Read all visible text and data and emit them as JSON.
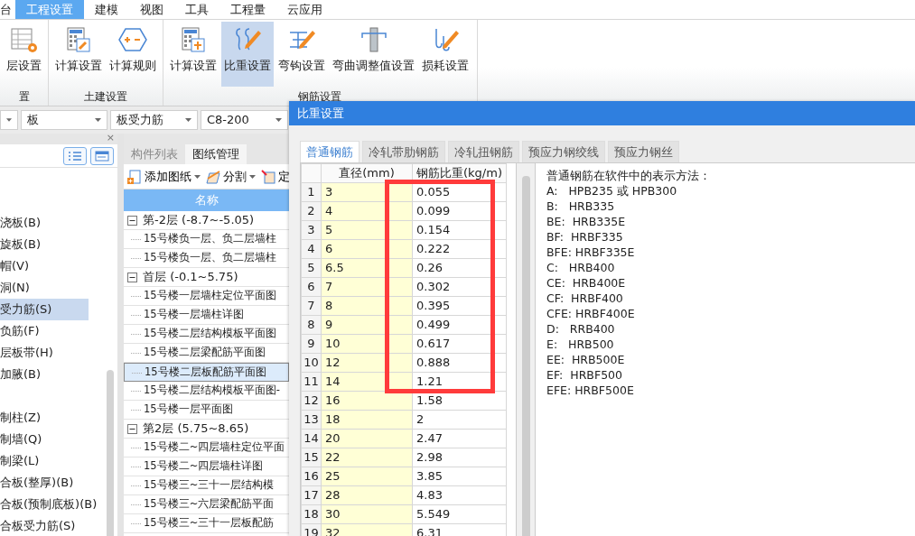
{
  "menu": [
    {
      "label": "台",
      "selected": false
    },
    {
      "label": "工程设置",
      "selected": true
    },
    {
      "label": "建模",
      "selected": false
    },
    {
      "label": "视图",
      "selected": false
    },
    {
      "label": "工具",
      "selected": false
    },
    {
      "label": "工程量",
      "selected": false
    },
    {
      "label": "云应用",
      "selected": false
    }
  ],
  "ribbon": [
    {
      "title": "置",
      "items": [
        {
          "label": "层设置",
          "kind": "floors",
          "selected": false
        }
      ]
    },
    {
      "title": "土建设置",
      "items": [
        {
          "label": "计算设置",
          "kind": "calcwrench",
          "selected": false
        },
        {
          "label": "计算规则",
          "kind": "rules",
          "selected": false
        }
      ]
    },
    {
      "title": "钢筋设置",
      "items": [
        {
          "label": "计算设置",
          "kind": "calcsplit",
          "selected": false
        },
        {
          "label": "比重设置",
          "kind": "density",
          "selected": true
        },
        {
          "label": "弯钩设置",
          "kind": "hook",
          "selected": false
        },
        {
          "label": "弯曲调整值设置",
          "kind": "bend",
          "selected": false
        },
        {
          "label": "损耗设置",
          "kind": "loss",
          "selected": false
        }
      ]
    }
  ],
  "selectors": [
    {
      "value": "板"
    },
    {
      "value": "板受力筋"
    },
    {
      "value": "C8-200"
    }
  ],
  "left_panel": {
    "close": "×",
    "groups": [
      [
        {
          "label": "浇板(B)",
          "selected": false
        },
        {
          "label": "旋板(B)",
          "selected": false
        },
        {
          "label": "帽(V)",
          "selected": false
        },
        {
          "label": "洞(N)",
          "selected": false
        },
        {
          "label": "受力筋(S)",
          "selected": true
        },
        {
          "label": "负筋(F)",
          "selected": false
        },
        {
          "label": "层板带(H)",
          "selected": false
        },
        {
          "label": "加腋(B)",
          "selected": false
        }
      ],
      [
        {
          "label": "制柱(Z)",
          "selected": false
        },
        {
          "label": "制墙(Q)",
          "selected": false
        },
        {
          "label": "制梁(L)",
          "selected": false
        },
        {
          "label": "合板(整厚)(B)",
          "selected": false
        },
        {
          "label": "合板(预制底板)(B)",
          "selected": false
        },
        {
          "label": "合板受力筋(S)",
          "selected": false
        }
      ]
    ]
  },
  "drawing_panel": {
    "tabs": [
      {
        "label": "构件列表",
        "selected": false
      },
      {
        "label": "图纸管理",
        "selected": true
      }
    ],
    "toolbar": [
      {
        "label": "添加图纸",
        "kind": "add",
        "dropdown": true
      },
      {
        "label": "分割",
        "kind": "split",
        "dropdown": true
      },
      {
        "label": "定",
        "kind": "locate",
        "dropdown": false
      }
    ],
    "column": "名称",
    "tree": [
      {
        "label": "第-2层 (-8.7~-5.05)",
        "expanded": true,
        "children": [
          {
            "label": "15号楼负一层、负二层墙柱",
            "selected": false
          },
          {
            "label": "15号楼负一层、负二层墙柱",
            "selected": false
          }
        ]
      },
      {
        "label": "首层 (-0.1~5.75)",
        "expanded": true,
        "children": [
          {
            "label": "15号楼一层墙柱定位平面图",
            "selected": false
          },
          {
            "label": "15号楼一层墙柱详图",
            "selected": false
          },
          {
            "label": "15号楼二层结构模板平面图",
            "selected": false
          },
          {
            "label": "15号楼二层梁配筋平面图",
            "selected": false
          },
          {
            "label": "15号楼二层板配筋平面图",
            "selected": true
          },
          {
            "label": "15号楼二层结构模板平面图-",
            "selected": false
          },
          {
            "label": "15号楼一层平面图",
            "selected": false
          }
        ]
      },
      {
        "label": "第2层 (5.75~8.65)",
        "expanded": true,
        "children": [
          {
            "label": "15号楼二~四层墙柱定位平面",
            "selected": false
          },
          {
            "label": "15号楼二~四层墙柱详图",
            "selected": false
          },
          {
            "label": "15号楼三~三十一层结构模",
            "selected": false
          },
          {
            "label": "15号楼三~六层梁配筋平面",
            "selected": false
          },
          {
            "label": "15号楼三~三十一层板配筋",
            "selected": false
          }
        ]
      }
    ]
  },
  "dialog": {
    "title": "比重设置",
    "tabs": [
      {
        "label": "普通钢筋",
        "selected": true
      },
      {
        "label": "冷轧带肋钢筋",
        "selected": false
      },
      {
        "label": "冷轧扭钢筋",
        "selected": false
      },
      {
        "label": "预应力钢绞线",
        "selected": false
      },
      {
        "label": "预应力钢丝",
        "selected": false
      }
    ],
    "table": {
      "columns": [
        "直径(mm)",
        "钢筋比重(kg/m)"
      ],
      "rows": [
        {
          "index": "1",
          "diameter": "3",
          "weight": "0.055",
          "highlighted": true
        },
        {
          "index": "2",
          "diameter": "4",
          "weight": "0.099",
          "highlighted": true
        },
        {
          "index": "3",
          "diameter": "5",
          "weight": "0.154",
          "highlighted": true
        },
        {
          "index": "4",
          "diameter": "6",
          "weight": "0.222",
          "highlighted": true
        },
        {
          "index": "5",
          "diameter": "6.5",
          "weight": "0.26",
          "highlighted": true
        },
        {
          "index": "6",
          "diameter": "7",
          "weight": "0.302",
          "highlighted": true
        },
        {
          "index": "7",
          "diameter": "8",
          "weight": "0.395",
          "highlighted": true
        },
        {
          "index": "8",
          "diameter": "9",
          "weight": "0.499",
          "highlighted": true
        },
        {
          "index": "9",
          "diameter": "10",
          "weight": "0.617",
          "highlighted": true
        },
        {
          "index": "10",
          "diameter": "12",
          "weight": "0.888",
          "highlighted": true
        },
        {
          "index": "11",
          "diameter": "14",
          "weight": "1.21",
          "highlighted": true
        },
        {
          "index": "12",
          "diameter": "16",
          "weight": "1.58",
          "highlighted": false
        },
        {
          "index": "13",
          "diameter": "18",
          "weight": "2",
          "highlighted": false
        },
        {
          "index": "14",
          "diameter": "20",
          "weight": "2.47",
          "highlighted": false
        },
        {
          "index": "15",
          "diameter": "22",
          "weight": "2.98",
          "highlighted": false
        },
        {
          "index": "16",
          "diameter": "25",
          "weight": "3.85",
          "highlighted": false
        },
        {
          "index": "17",
          "diameter": "28",
          "weight": "4.83",
          "highlighted": false
        },
        {
          "index": "18",
          "diameter": "30",
          "weight": "5.549",
          "highlighted": false
        },
        {
          "index": "19",
          "diameter": "32",
          "weight": "6.31",
          "highlighted": false
        }
      ]
    },
    "legend": {
      "title": "普通钢筋在软件中的表示方法：",
      "lines": [
        "A:   HPB235 或 HPB300",
        "B:   HRB335",
        "BE:  HRB335E",
        "BF:  HRBF335",
        "BFE: HRBF335E",
        "C:   HRB400",
        "CE:  HRB400E",
        "CF:  HRBF400",
        "CFE: HRBF400E",
        "D:   RRB400",
        "E:   HRB500",
        "EE:  HRB500E",
        "EF:  HRBF500",
        "EFE: HRBF500E"
      ]
    }
  }
}
